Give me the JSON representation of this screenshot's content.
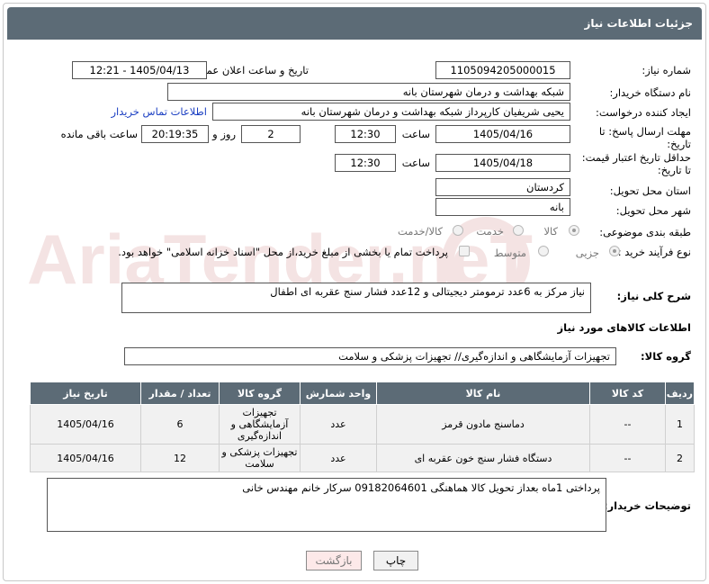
{
  "title": "جزئیات اطلاعات نیاز",
  "watermark": "AriaTender.neT",
  "fields": {
    "need_number_label": "شماره نیاز:",
    "need_number": "1105094205000015",
    "announce_label": "تاریخ و ساعت اعلان عمومی:",
    "announce_value": "1405/04/13 - 12:21",
    "buyer_org_label": "نام دستگاه خریدار:",
    "buyer_org": "شبکه بهداشت و درمان شهرستان بانه",
    "creator_label": "ایجاد کننده درخواست:",
    "creator": "یحیی شریفیان کارپرداز شبکه بهداشت و درمان شهرستان بانه",
    "contact_link": "اطلاعات تماس خریدار",
    "deadline_label_1": "مهلت ارسال پاسخ: تا",
    "deadline_label_2": "تاریخ:",
    "deadline_date": "1405/04/16",
    "time_label": "ساعت",
    "deadline_time": "12:30",
    "days_count": "2",
    "days_label": "روز و",
    "remaining_time": "20:19:35",
    "remaining_label": "ساعت باقی مانده",
    "validity_label_1": "حداقل تاریخ اعتبار قیمت:",
    "validity_label_2": "تا تاریخ:",
    "validity_date": "1405/04/18",
    "validity_time": "12:30",
    "province_label": "استان محل تحویل:",
    "province": "کردستان",
    "city_label": "شهر محل تحویل:",
    "city": "بانه",
    "category_label": "طبقه بندی موضوعی:",
    "category_options": [
      "کالا",
      "خدمت",
      "کالا/خدمت"
    ],
    "process_label": "نوع فرآیند خرید :",
    "process_options": [
      "جزیی",
      "متوسط"
    ],
    "payment_note": "پرداخت تمام یا بخشی از مبلغ خرید،از محل \"اسناد خزانه اسلامی\" خواهد بود."
  },
  "summary": {
    "label": "شرح کلی نیاز:",
    "text": "نیاز مرکز به 6عدد ترمومتر دیجیتالی و 12عدد فشار سنج عقربه ای اطفال"
  },
  "goods_section_title": "اطلاعات کالاهای مورد نیاز",
  "goods_group": {
    "label": "گروه کالا:",
    "value": "تجهیزات آزمایشگاهی و اندازه‌گیری// تجهیزات پزشکی و سلامت"
  },
  "table": {
    "headers": [
      "ردیف",
      "کد کالا",
      "نام کالا",
      "واحد شمارش",
      "گروه کالا",
      "تعداد / مقدار",
      "تاریخ نیاز"
    ],
    "rows": [
      [
        "1",
        "--",
        "دماسنج مادون قرمز",
        "عدد",
        "تجهیزات آزمایشگاهی و اندازه‌گیری",
        "6",
        "1405/04/16"
      ],
      [
        "2",
        "--",
        "دستگاه فشار سنج خون عقربه ای",
        "عدد",
        "تجهیزات پزشکی و سلامت",
        "12",
        "1405/04/16"
      ]
    ]
  },
  "buyer_notes": {
    "label": "توضیحات خریدار:",
    "text": "پرداختی 1ماه بعداز تحویل کالا هماهنگی 09182064601 سرکار خانم مهندس خانی"
  },
  "buttons": {
    "print": "چاپ",
    "back": "بازگشت"
  },
  "colors": {
    "header_bg": "#5c6b76",
    "link": "#1a3ec2",
    "back_bg": "#fde9e9"
  }
}
